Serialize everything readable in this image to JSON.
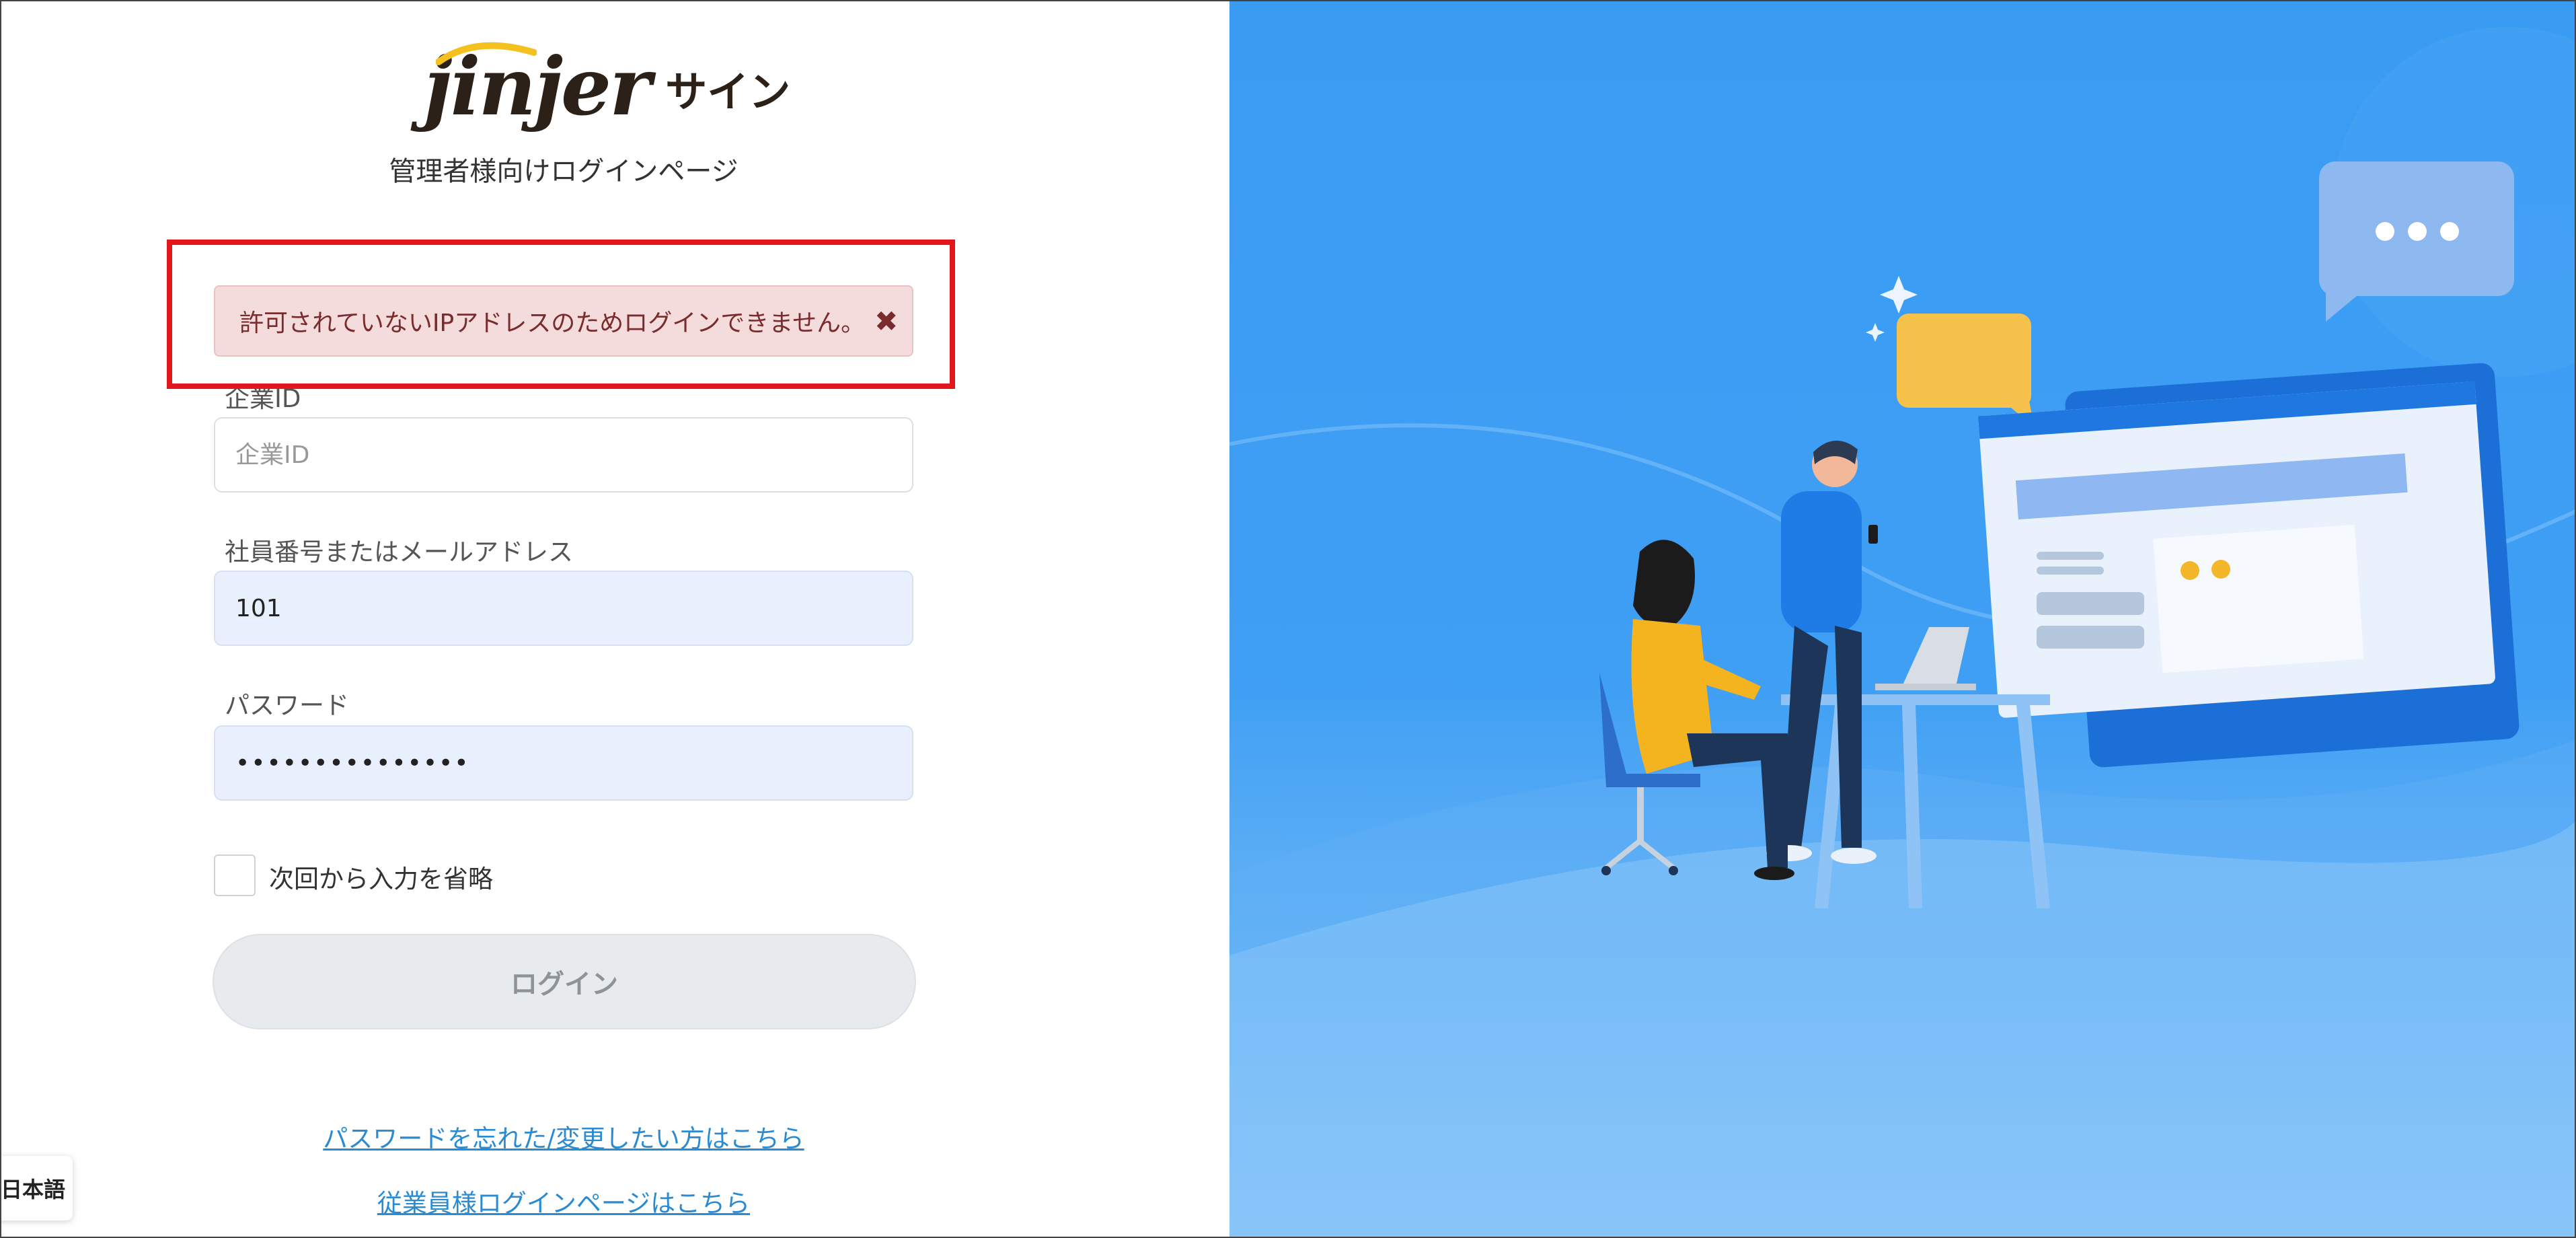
{
  "brand": {
    "logo_word": "jinjer",
    "logo_product": "サイン",
    "subtitle": "管理者様向けログインページ"
  },
  "alert": {
    "message": "許可されていないIPアドレスのためログインできません。",
    "close_icon": "close-icon",
    "highlight_color": "#e3161b"
  },
  "form": {
    "company_id": {
      "label": "企業ID",
      "placeholder": "企業ID",
      "value": ""
    },
    "employee": {
      "label": "社員番号またはメールアドレス",
      "value": "101"
    },
    "password": {
      "label": "パスワード",
      "value": "•••••••••••••••"
    },
    "remember": {
      "label": "次回から入力を省略",
      "checked": false
    },
    "login_button": "ログイン"
  },
  "links": {
    "forgot_password": "パスワードを忘れた/変更したい方はこちら",
    "employee_login": "従業員様ログインページはこちら"
  },
  "language": {
    "label": "日本語"
  },
  "illustration": {
    "icon": "office-illustration",
    "accent": "#3a9bf3"
  }
}
